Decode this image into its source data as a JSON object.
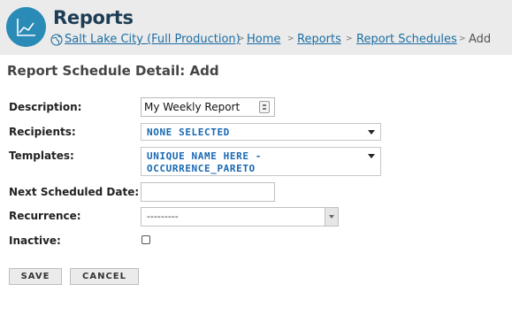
{
  "app": {
    "title": "Reports",
    "icon": "line-chart-icon",
    "accent_color": "#2a8bb7"
  },
  "breadcrumb": {
    "items": [
      {
        "label": "Salt Lake City (Full Production)",
        "icon": "globe-icon"
      },
      {
        "label": "Home"
      },
      {
        "label": "Reports"
      },
      {
        "label": "Report Schedules"
      }
    ],
    "separator": ">",
    "current": "Add"
  },
  "page": {
    "title": "Report Schedule Detail: Add"
  },
  "form": {
    "description": {
      "label": "Description:",
      "value": "My Weekly Report"
    },
    "recipients": {
      "label": "Recipients:",
      "value": "NONE SELECTED"
    },
    "templates": {
      "label": "Templates:",
      "value_line1": "UNIQUE NAME HERE -",
      "value_line2": "OCCURRENCE_PARETO"
    },
    "next_date": {
      "label": "Next Scheduled Date:",
      "value": ""
    },
    "recurrence": {
      "label": "Recurrence:",
      "value": "---------"
    },
    "inactive": {
      "label": "Inactive:",
      "checked": false
    }
  },
  "buttons": {
    "save": "SAVE",
    "cancel": "CANCEL"
  }
}
